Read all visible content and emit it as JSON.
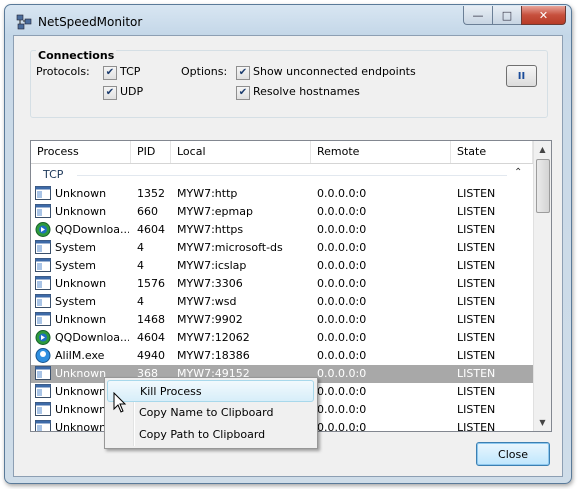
{
  "window": {
    "title": "NetSpeedMonitor",
    "close_glyph": "✕",
    "min_glyph": "—",
    "max_glyph": "□"
  },
  "connections": {
    "group_title": "Connections",
    "protocols_label": "Protocols:",
    "tcp_label": "TCP",
    "tcp_checked": true,
    "udp_label": "UDP",
    "udp_checked": true,
    "options_label": "Options:",
    "show_unconnected_label": "Show unconnected endpoints",
    "show_unconnected_checked": true,
    "resolve_hostnames_label": "Resolve hostnames",
    "resolve_hostnames_checked": true,
    "pause_glyph": "II"
  },
  "table": {
    "columns": [
      "Process",
      "PID",
      "Local",
      "Remote",
      "State"
    ],
    "group": "TCP",
    "rows": [
      {
        "icon": "window-icon",
        "process": "Unknown",
        "pid": "1352",
        "local": "MYW7:http",
        "remote": "0.0.0.0:0",
        "state": "LISTEN"
      },
      {
        "icon": "window-icon",
        "process": "Unknown",
        "pid": "660",
        "local": "MYW7:epmap",
        "remote": "0.0.0.0:0",
        "state": "LISTEN"
      },
      {
        "icon": "qq-download-icon",
        "process": "QQDownloa...",
        "pid": "4604",
        "local": "MYW7:https",
        "remote": "0.0.0.0:0",
        "state": "LISTEN"
      },
      {
        "icon": "window-icon",
        "process": "System",
        "pid": "4",
        "local": "MYW7:microsoft-ds",
        "remote": "0.0.0.0:0",
        "state": "LISTEN"
      },
      {
        "icon": "window-icon",
        "process": "System",
        "pid": "4",
        "local": "MYW7:icslap",
        "remote": "0.0.0.0:0",
        "state": "LISTEN"
      },
      {
        "icon": "window-icon",
        "process": "Unknown",
        "pid": "1576",
        "local": "MYW7:3306",
        "remote": "0.0.0.0:0",
        "state": "LISTEN"
      },
      {
        "icon": "window-icon",
        "process": "System",
        "pid": "4",
        "local": "MYW7:wsd",
        "remote": "0.0.0.0:0",
        "state": "LISTEN"
      },
      {
        "icon": "window-icon",
        "process": "Unknown",
        "pid": "1468",
        "local": "MYW7:9902",
        "remote": "0.0.0.0:0",
        "state": "LISTEN"
      },
      {
        "icon": "qq-download-icon",
        "process": "QQDownloa...",
        "pid": "4604",
        "local": "MYW7:12062",
        "remote": "0.0.0.0:0",
        "state": "LISTEN"
      },
      {
        "icon": "aliim-icon",
        "process": "AliIM.exe",
        "pid": "4940",
        "local": "MYW7:18386",
        "remote": "0.0.0.0:0",
        "state": "LISTEN"
      },
      {
        "icon": "window-icon",
        "process": "Unknown",
        "pid": "368",
        "local": "MYW7:49152",
        "remote": "0.0.0.0:0",
        "state": "LISTEN",
        "selected": true
      },
      {
        "icon": "window-icon",
        "process": "Unknown",
        "pid": "",
        "local": "",
        "remote": "0.0.0.0:0",
        "state": "LISTEN"
      },
      {
        "icon": "window-icon",
        "process": "Unknown",
        "pid": "",
        "local": "",
        "remote": "0.0.0.0:0",
        "state": "LISTEN"
      },
      {
        "icon": "window-icon",
        "process": "Unknown",
        "pid": "",
        "local": "",
        "remote": "0.0.0.0:0",
        "state": "LISTEN"
      }
    ]
  },
  "context_menu": {
    "items": [
      "Kill Process",
      "Copy Name to Clipboard",
      "Copy Path to Clipboard"
    ]
  },
  "footer": {
    "close_label": "Close"
  },
  "colors": {
    "selection": "#a8a8a8",
    "group_text": "#1e395b",
    "window_frame": "#c4d7e8"
  }
}
